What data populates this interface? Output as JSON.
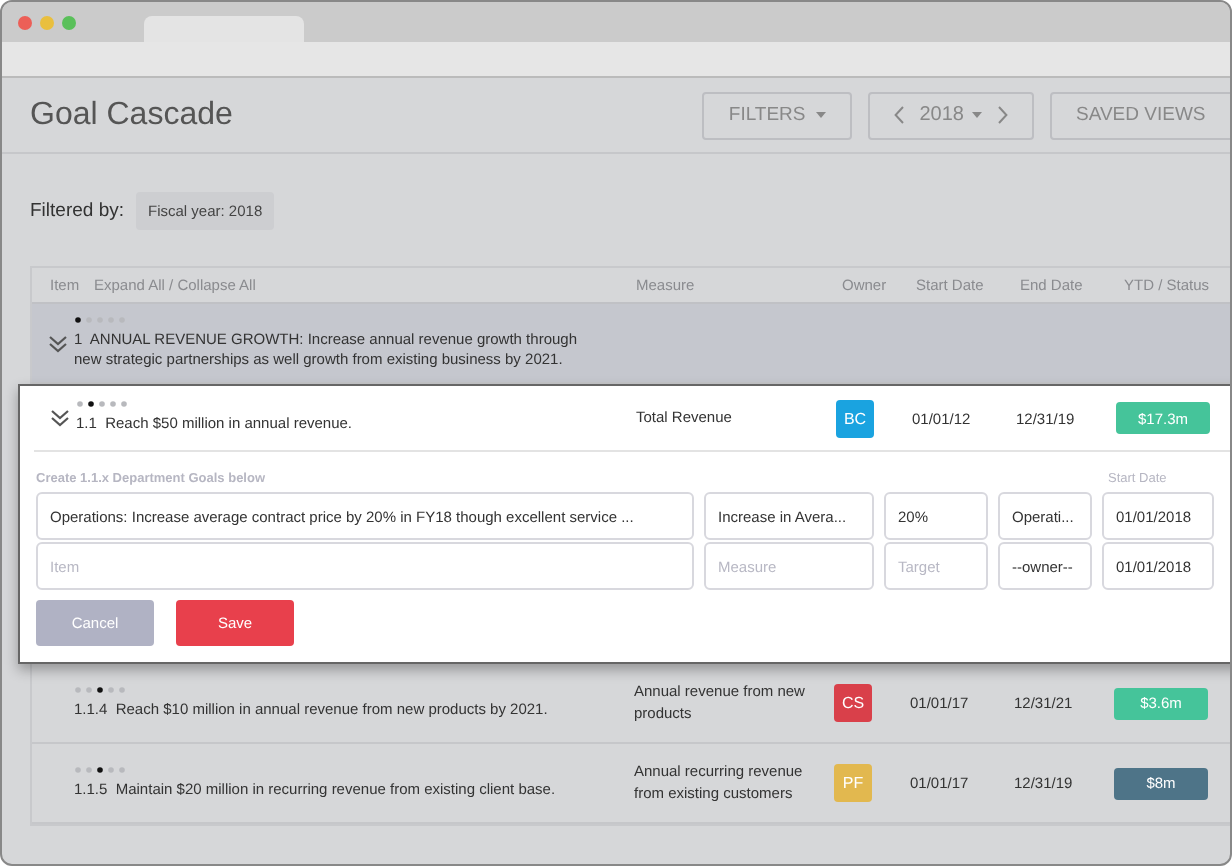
{
  "page": {
    "title": "Goal Cascade"
  },
  "toolbar": {
    "filters": "FILTERS",
    "year": "2018",
    "saved_views": "SAVED VIEWS"
  },
  "filter": {
    "label": "Filtered by:",
    "chips": [
      "Fiscal year: 2018"
    ]
  },
  "table": {
    "columns": [
      "Item",
      "Expand All / Collapse All",
      "Measure",
      "Owner",
      "Start Date",
      "End Date",
      "YTD / Status"
    ],
    "goals": [
      {
        "number": "1",
        "text": "ANNUAL REVENUE GROWTH: Increase annual revenue growth through new strategic partnerships as well growth from existing business by 2021.",
        "expanded": true,
        "children": [
          {
            "number": "1.1",
            "text": "Reach $50 million in annual revenue.",
            "measure": "Total Revenue",
            "owner": {
              "initials": "BC",
              "color": "#1aa3e0"
            },
            "start": "01/01/12",
            "end": "12/31/19",
            "ytd": {
              "value": "$17.3m",
              "color": "#45c49a"
            },
            "expanded": true,
            "form": {
              "heading": "Create 1.1.x Department Goals below",
              "start_label": "Start Date",
              "rows": [
                [
                  {
                    "value": "Operations: Increase average contract price by 20% in FY18 though excellent service ..."
                  },
                  {
                    "value": "Increase in Avera..."
                  },
                  {
                    "value": "20%"
                  },
                  {
                    "value": "Operati..."
                  },
                  {
                    "value": "01/01/2018"
                  }
                ],
                [
                  {
                    "placeholder": "Item"
                  },
                  {
                    "placeholder": "Measure"
                  },
                  {
                    "placeholder": "Target"
                  },
                  {
                    "value": "--owner--"
                  },
                  {
                    "value": "01/01/2018"
                  }
                ]
              ],
              "cancel": "Cancel",
              "save": "Save"
            },
            "children": [
              {
                "number": "1.1.4",
                "text": "Reach $10 million in annual revenue from new products by 2021.",
                "measure": "Annual revenue from new products",
                "owner": {
                  "initials": "CS",
                  "color": "#d9404a"
                },
                "start": "01/01/17",
                "end": "12/31/21",
                "ytd": {
                  "value": "$3.6m",
                  "color": "#45c49a"
                }
              },
              {
                "number": "1.1.5",
                "text": "Maintain $20 million in recurring revenue from existing client base.",
                "measure": "Annual recurring revenue from existing customers",
                "owner": {
                  "initials": "PF",
                  "color": "#e2b84f"
                },
                "start": "01/01/17",
                "end": "12/31/19",
                "ytd": {
                  "value": "$8m",
                  "color": "#4e7488"
                }
              }
            ]
          }
        ]
      }
    ]
  }
}
